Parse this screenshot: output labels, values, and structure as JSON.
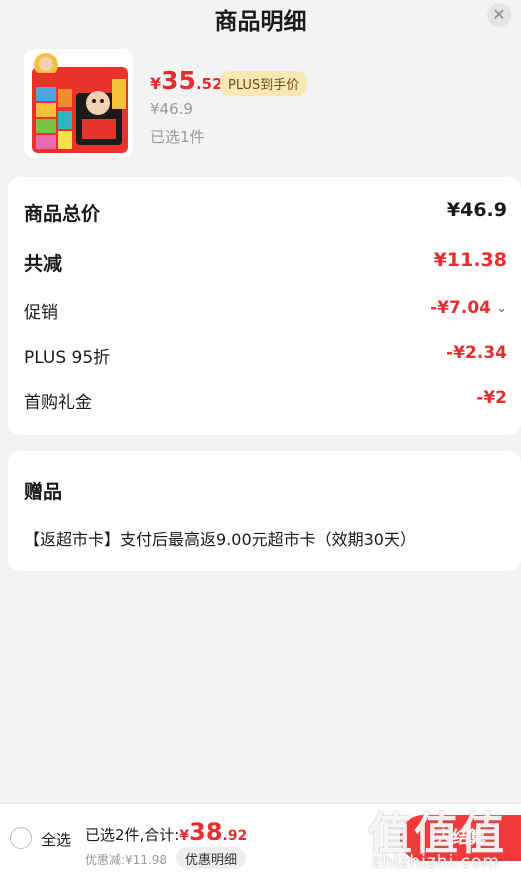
{
  "header": {
    "title": "商品明细",
    "close_icon": "close-icon"
  },
  "product": {
    "price_yen": "¥",
    "price_int": "35",
    "price_dec": ".52",
    "plus_tag": "PLUS到手价",
    "original_price": "¥46.9",
    "selected_count": "已选1件",
    "image_name": "snack-gift-pack-image"
  },
  "breakdown": {
    "total_label": "商品总价",
    "total_value": "¥46.9",
    "reduce_label": "共减",
    "reduce_value": "¥11.38",
    "promo_label": "促销",
    "promo_value": "-¥7.04",
    "plus_label": "PLUS 95折",
    "plus_value": "-¥2.34",
    "first_label": "首购礼金",
    "first_value": "-¥2"
  },
  "gift": {
    "title": "赠品",
    "desc": "【返超市卡】支付后最高返9.00元超市卡（效期30天）"
  },
  "bottom": {
    "select_all": "全选",
    "sum_label": "已选2件,合计:",
    "sum_yen": "¥",
    "sum_int": "38",
    "sum_dec": ".92",
    "discount": "优惠减:¥11.98",
    "detail_button": "优惠明细",
    "checkout_button": "去结算"
  },
  "watermark": {
    "big": "值值值",
    "small": "zhizhizhi.com"
  },
  "colors": {
    "accent_red": "#e62e2e",
    "plus_tag_bg": "#f7e8b6",
    "checkout_bg": "#f23a3a"
  }
}
